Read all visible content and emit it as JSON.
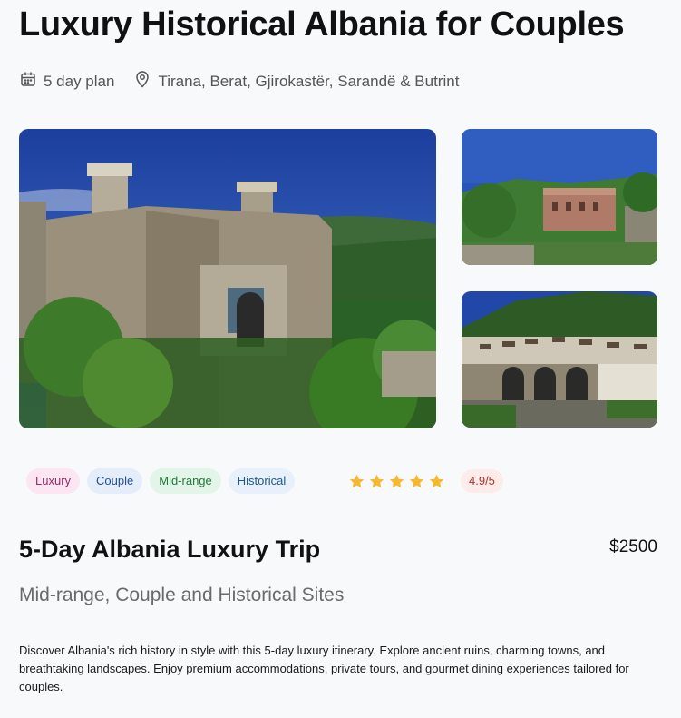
{
  "header": {
    "title": "Luxury Historical Albania for Couples",
    "duration": "5 day plan",
    "locations": "Tirana, Berat, Gjirokastër, Sarandë & Butrint"
  },
  "gallery": {
    "images": [
      {
        "icon": "castle-ruins-photo"
      },
      {
        "icon": "hill-fortress-photo"
      },
      {
        "icon": "old-town-photo"
      }
    ]
  },
  "tags": [
    "Luxury",
    "Couple",
    "Mid-range",
    "Historical"
  ],
  "rating": {
    "stars": 5,
    "value_label": "4.9/5"
  },
  "trip": {
    "name": "5-Day Albania Luxury Trip",
    "price": "$2500",
    "subtitle": "Mid-range, Couple and Historical Sites",
    "description": "Discover Albania's rich history in style with this 5-day luxury itinerary. Explore ancient ruins, charming towns, and breathtaking landscapes. Enjoy premium accommodations, private tours, and gourmet dining experiences tailored for couples."
  },
  "colors": {
    "star": "#f5b82e",
    "tag_luxury": "#a0276a",
    "tag_couple": "#1f4f99",
    "tag_midrange": "#1f7a3a",
    "tag_historical": "#1c5a8c"
  }
}
